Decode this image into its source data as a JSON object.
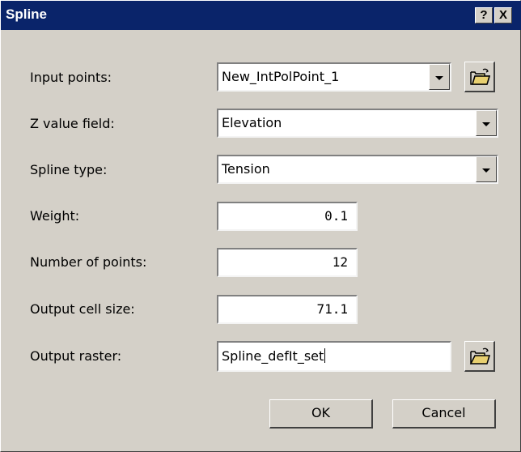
{
  "window": {
    "title": "Spline",
    "help_label": "?",
    "close_label": "X"
  },
  "form": {
    "input_points": {
      "label": "Input points:",
      "value": "New_IntPolPoint_1"
    },
    "z_value_field": {
      "label": "Z value field:",
      "value": "Elevation"
    },
    "spline_type": {
      "label": "Spline type:",
      "value": "Tension"
    },
    "weight": {
      "label": "Weight:",
      "value": "0.1"
    },
    "number_of_points": {
      "label": "Number of points:",
      "value": "12"
    },
    "output_cell_size": {
      "label": "Output cell size:",
      "value": "71.1"
    },
    "output_raster": {
      "label": "Output raster:",
      "value": "Spline_defIt_set"
    }
  },
  "buttons": {
    "ok_label": "OK",
    "cancel_label": "Cancel"
  },
  "icons": {
    "browse": "folder-open-icon",
    "dropdown": "chevron-down-icon"
  },
  "colors": {
    "titlebar": "#0a246a",
    "face": "#d4d0c8"
  }
}
